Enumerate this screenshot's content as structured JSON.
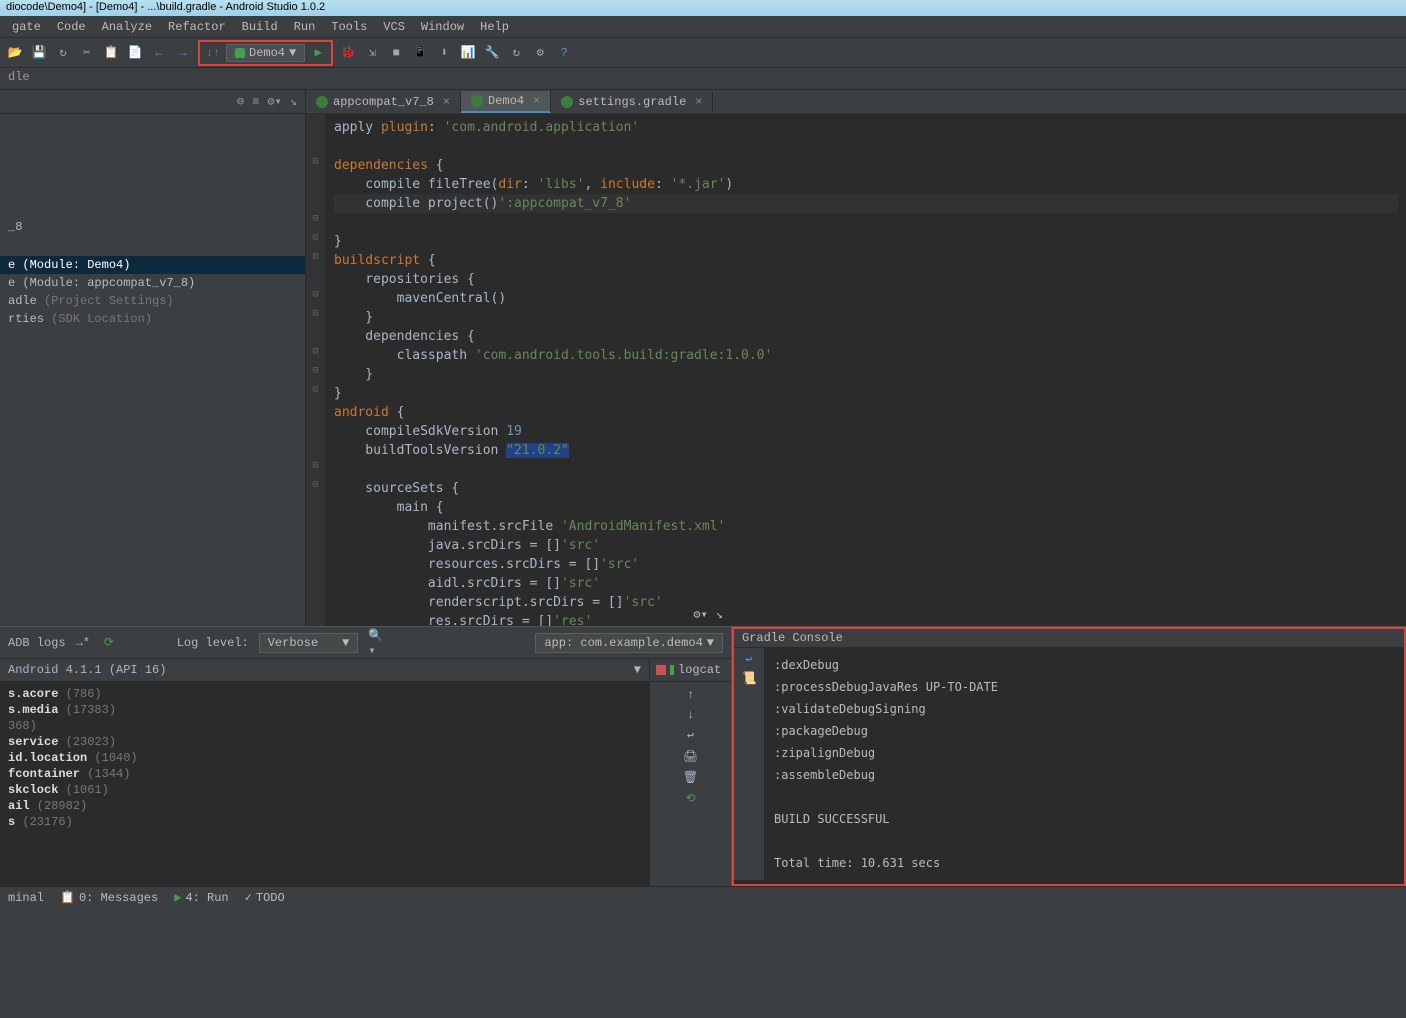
{
  "title": "diocode\\Demo4] - [Demo4] - ...\\build.gradle - Android Studio 1.0.2",
  "menu": [
    "gate",
    "Code",
    "Analyze",
    "Refactor",
    "Build",
    "Run",
    "Tools",
    "VCS",
    "Window",
    "Help"
  ],
  "run_config": "Demo4",
  "breadcrumb": "dle",
  "project_tree": [
    {
      "label": "_8",
      "dim": ""
    },
    {
      "label": "e (Module: Demo4)",
      "selected": true
    },
    {
      "label": "e (Module: appcompat_v7_8)"
    },
    {
      "label": "adle ",
      "dim": "(Project Settings)"
    },
    {
      "label": "rties ",
      "dim": "(SDK Location)"
    }
  ],
  "tabs": [
    {
      "label": "appcompat_v7_8",
      "active": false
    },
    {
      "label": "Demo4",
      "active": true
    },
    {
      "label": "settings.gradle",
      "active": false
    }
  ],
  "code": {
    "lines": [
      {
        "t": "apply ",
        "k": "plugin",
        "r": ": ",
        "s": "'com.android.application'"
      },
      {
        "blank": true
      },
      {
        "k": "dependencies",
        "r": " {"
      },
      {
        "i": 1,
        "t": "compile fileTree(",
        "k2": "dir",
        "r2": ": ",
        "s": "'libs'",
        "r3": ", ",
        "k3": "include",
        "r4": ": ",
        "s2": "'*.jar'",
        "r5": ")"
      },
      {
        "i": 1,
        "t": "compile project(",
        "s": "':appcompat_v7_8'",
        "r2": ")",
        "cur": true
      },
      {
        "r": "}"
      },
      {
        "k": "buildscript",
        "r": " {"
      },
      {
        "i": 1,
        "t": "repositories {"
      },
      {
        "i": 2,
        "t": "mavenCentral()"
      },
      {
        "i": 1,
        "t": "}"
      },
      {
        "i": 1,
        "t": "dependencies {"
      },
      {
        "i": 2,
        "t": "classpath ",
        "s": "'com.android.tools.build:gradle:1.0.0'"
      },
      {
        "i": 1,
        "t": "}"
      },
      {
        "r": "}"
      },
      {
        "k": "android",
        "r": " {"
      },
      {
        "i": 1,
        "t": "compileSdkVersion ",
        "n": "19"
      },
      {
        "i": 1,
        "t": "buildToolsVersion ",
        "hl": "\"21.0.2\""
      },
      {
        "blank": true
      },
      {
        "i": 1,
        "t": "sourceSets {"
      },
      {
        "i": 2,
        "t": "main {"
      },
      {
        "i": 3,
        "t": "manifest.srcFile ",
        "s": "'AndroidManifest.xml'"
      },
      {
        "i": 3,
        "t": "java.srcDirs = [",
        "s": "'src'",
        "r2": "]"
      },
      {
        "i": 3,
        "t": "resources.srcDirs = [",
        "s": "'src'",
        "r2": "]"
      },
      {
        "i": 3,
        "t": "aidl.srcDirs = [",
        "s": "'src'",
        "r2": "]"
      },
      {
        "i": 3,
        "t": "renderscript.srcDirs = [",
        "s": "'src'",
        "r2": "]"
      },
      {
        "i": 3,
        "t": "res.srcDirs = [",
        "s": "'res'",
        "r2": "]"
      }
    ]
  },
  "logcat": {
    "adb_label": "ADB logs",
    "log_level_label": "Log level:",
    "log_level": "Verbose",
    "app_filter": "app: com.example.demo4",
    "device": "Android 4.1.1 (API 16)",
    "tab_label": "logcat",
    "lines": [
      {
        "bold": "s.acore",
        "dim": " (786)"
      },
      {
        "bold": "s.media",
        "dim": " (17383)"
      },
      {
        "dim": "368)"
      },
      {
        "bold": "service",
        "dim": " (23023)"
      },
      {
        "bold": "id.location",
        "dim": " (1040)"
      },
      {
        "bold": "fcontainer",
        "dim": " (1344)"
      },
      {
        "bold": "skclock",
        "dim": " (1061)"
      },
      {
        "bold": "ail",
        "dim": " (28982)"
      },
      {
        "bold": "s",
        "dim": " (23176)"
      }
    ]
  },
  "gradle_console": {
    "title": "Gradle Console",
    "lines": [
      ":dexDebug",
      ":processDebugJavaRes UP-TO-DATE",
      ":validateDebugSigning",
      ":packageDebug",
      ":zipalignDebug",
      ":assembleDebug",
      "",
      "BUILD SUCCESSFUL",
      "",
      "Total time: 10.631 secs"
    ]
  },
  "statusbar": {
    "terminal": "minal",
    "messages": "0: Messages",
    "run": "4: Run",
    "todo": "TODO"
  }
}
